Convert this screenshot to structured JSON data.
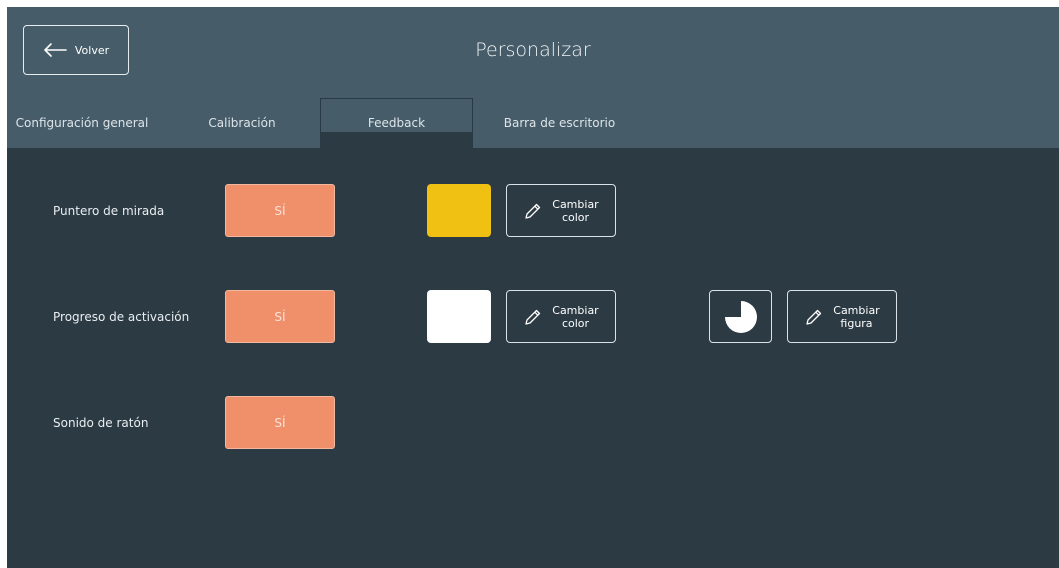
{
  "header": {
    "back_label": "Volver",
    "title": "Personalizar"
  },
  "tabs": [
    {
      "label": "Configuración general",
      "active": false
    },
    {
      "label": "Calibración",
      "active": false
    },
    {
      "label": "Feedback",
      "active": true
    },
    {
      "label": "Barra de escritorio",
      "active": false
    }
  ],
  "rows": [
    {
      "label": "Puntero de mirada",
      "toggle": "SÍ",
      "color": "#f0c013",
      "change_color": [
        "Cambiar",
        "color"
      ]
    },
    {
      "label": "Progreso de activación",
      "toggle": "SÍ",
      "color": "#ffffff",
      "change_color": [
        "Cambiar",
        "color"
      ],
      "shape_icon": "pie-progress-icon",
      "change_shape": [
        "Cambiar",
        "figura"
      ]
    },
    {
      "label": "Sonido de ratón",
      "toggle": "SÍ"
    }
  ],
  "colors": {
    "background": "#2c3a44",
    "header": "#465c69",
    "accent": "#ef906b"
  }
}
